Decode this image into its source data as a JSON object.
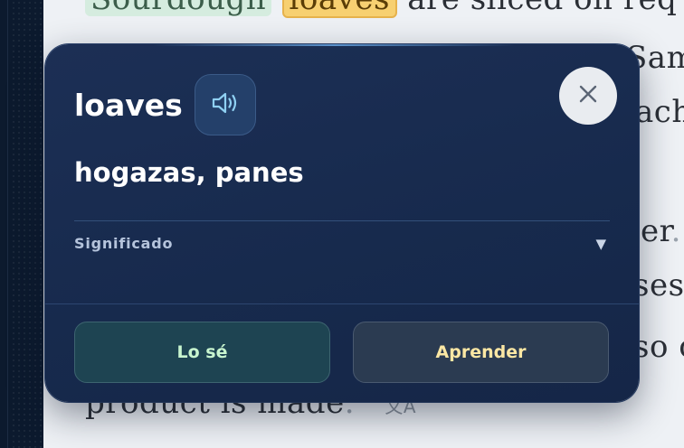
{
  "background_article": {
    "line1": {
      "chip_green": "Sourdough",
      "chip_yellow": "loaves",
      "rest": "are sliced on req"
    },
    "fragments": {
      "sam": "Sam",
      "ach": "ach",
      "er": "er",
      "ses": "ses",
      "so_c": "so c"
    },
    "last_line": "product is made",
    "translate_glyph": "文A"
  },
  "popup": {
    "word": "loaves",
    "speak_icon": "speaker-icon",
    "close_icon": "close-icon",
    "translation": "hogazas, panes",
    "meaning_label": "Significado",
    "meaning_caret": "▼",
    "buttons": {
      "know_label": "Lo sé",
      "learn_label": "Aprender"
    }
  },
  "colors": {
    "popup_bg": "#1a2d52",
    "know_text": "#c8f5cf",
    "learn_text": "#fbe7a4",
    "highlight_yellow": "#f7d071",
    "highlight_green": "#d5ecdf"
  }
}
